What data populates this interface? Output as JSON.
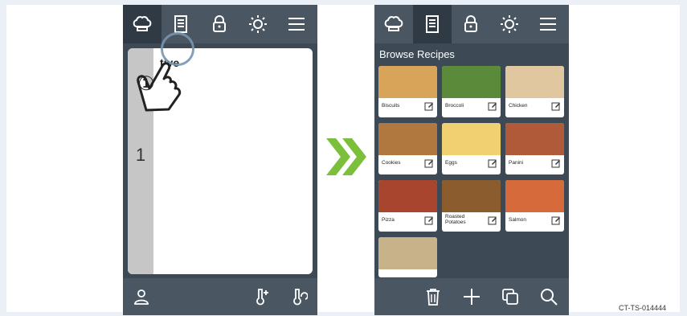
{
  "left_screen": {
    "tabs": [
      {
        "name": "chef-hat-icon",
        "active": true
      },
      {
        "name": "recipe-list-icon",
        "active": false
      },
      {
        "name": "lock-icon",
        "active": false
      },
      {
        "name": "brightness-icon",
        "active": false
      },
      {
        "name": "menu-icon",
        "active": false
      }
    ],
    "content_title": "tive",
    "strip_number": "1",
    "tap_step": "①",
    "bottom_buttons": [
      "chef-profile-icon",
      "thermometer-up-icon",
      "thermometer-refresh-icon"
    ]
  },
  "right_screen": {
    "tabs": [
      {
        "name": "chef-hat-icon",
        "active": false
      },
      {
        "name": "recipe-list-icon",
        "active": true
      },
      {
        "name": "lock-icon",
        "active": false
      },
      {
        "name": "brightness-icon",
        "active": false
      },
      {
        "name": "menu-icon",
        "active": false
      }
    ],
    "browse_title": "Browse Recipes",
    "recipes": [
      {
        "label": "Biscuits",
        "color": "#d8a45a"
      },
      {
        "label": "Broccoli",
        "color": "#5a8a3a"
      },
      {
        "label": "Chicken",
        "color": "#e1c7a0"
      },
      {
        "label": "Cookies",
        "color": "#b0783f"
      },
      {
        "label": "Eggs",
        "color": "#f0d070"
      },
      {
        "label": "Panini",
        "color": "#b05a3a"
      },
      {
        "label": "Pizza",
        "color": "#a8452f"
      },
      {
        "label": "Roasted Potatoes",
        "color": "#8a5c2e"
      },
      {
        "label": "Salmon",
        "color": "#d76a3a"
      },
      {
        "label": "",
        "color": "#c8b28a"
      }
    ],
    "bottom_buttons": [
      "trash-icon",
      "add-icon",
      "copy-icon",
      "search-icon"
    ]
  },
  "doc_id": "CT-TS-014444",
  "colors": {
    "panel": "#3d4a56",
    "bar": "#4a5763",
    "arrow": "#7cbf3a"
  }
}
